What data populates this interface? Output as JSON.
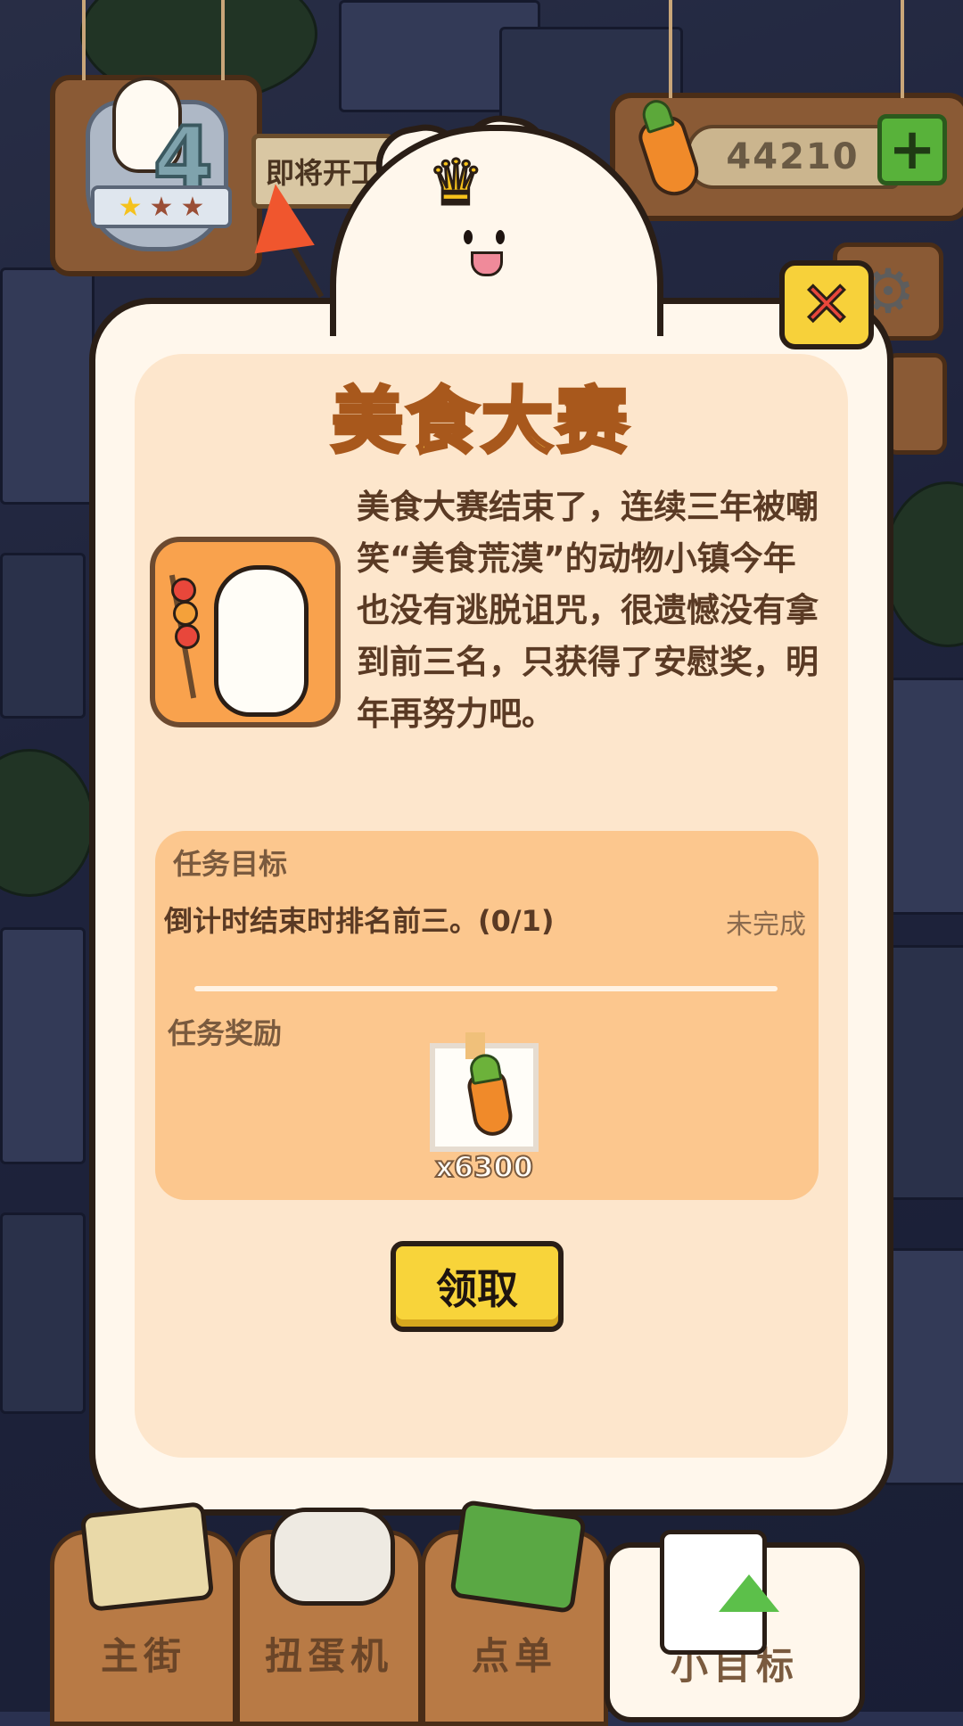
{
  "hud": {
    "level": "4",
    "stars": [
      "★",
      "★",
      "★"
    ],
    "soon_label": "即将开工",
    "carrot_count": "44210",
    "plus_label": "+",
    "settings_icon": "gear-icon"
  },
  "modal": {
    "title": "美食大赛",
    "description": "美食大赛结束了，连续三年被嘲笑“美食荒漠”的动物小镇今年也没有逃脱诅咒，很遗憾没有拿到前三名，只获得了安慰奖，明年再努力吧。",
    "close_label": "✕",
    "task_goal_label": "任务目标",
    "task_desc": "倒计时结束时排名前三。(0/1)",
    "task_status": "未完成",
    "task_reward_label": "任务奖励",
    "reward_count": "x6300",
    "claim_label": "领取"
  },
  "nav": {
    "items": [
      {
        "label": "主街"
      },
      {
        "label": "扭蛋机"
      },
      {
        "label": "点单"
      },
      {
        "label": "小目标"
      }
    ]
  },
  "colors": {
    "accent_yellow": "#f8d43a",
    "title_orange": "#f7c84a",
    "panel_peach": "#fde6cc",
    "task_box": "#fcc78e",
    "close_red": "#e8473b"
  }
}
